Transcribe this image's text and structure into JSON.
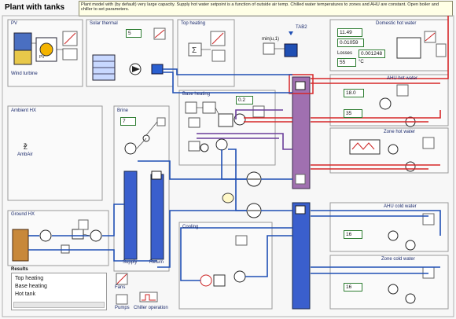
{
  "title": "Plant with tanks",
  "note": "Plant model with (by default) very large capacity. Supply hot water setpoint is a function of outside air temp. Chilled water temperatures to zones and AHU are constant. Open boiler and chiller to set parameters.",
  "sections": {
    "pv": "PV",
    "solar_thermal": "Solar thermal",
    "top_heating": "Top heating",
    "domestic_hot_water": "Domestic hot water",
    "wind_turbine": "Wind turbine",
    "base_heating": "Base heating",
    "ambient_hx": "Ambient HX",
    "brine": "Brine",
    "ahu_hot_water": "AHU hot water",
    "zone_hot_water": "Zone hot water",
    "ground_hx": "Ground HX",
    "cooling": "Cooling",
    "ahu_cold_water": "AHU cold water",
    "zone_cold_water": "Zone cold water",
    "results": "Results"
  },
  "labels": {
    "tab2": "TAB2",
    "mmin": "min(u,1)",
    "losses": "Losses",
    "deg_c": "°C",
    "ambair": "AmbAir",
    "supply": "Supply",
    "return": "Return",
    "fans": "Fans",
    "pumps": "Pumps",
    "chiller_operation": "Chiller operation",
    "pv_label": "PV",
    "z_label": "Z"
  },
  "values": {
    "solar": "5",
    "base": "0.2",
    "brine": "7",
    "dhw_a": "11.49",
    "dhw_b": "0.01059",
    "dhw_loss": "0.001248",
    "dhw_temp": "55",
    "ahu_hot": "18.0",
    "ahu_hot2": "35",
    "ahu_cold": "16",
    "zone_cold": "16"
  },
  "results": [
    "Top heating",
    "Base heating",
    "Hot tank"
  ],
  "colors": {
    "hot_pipe": "#d62728",
    "cold_pipe": "#1f4fb4",
    "warm_pipe": "#6a3d9a",
    "tank_hot": "#a070b0",
    "tank_cold": "#3a5fcd",
    "frame": "#9a9a9a"
  }
}
